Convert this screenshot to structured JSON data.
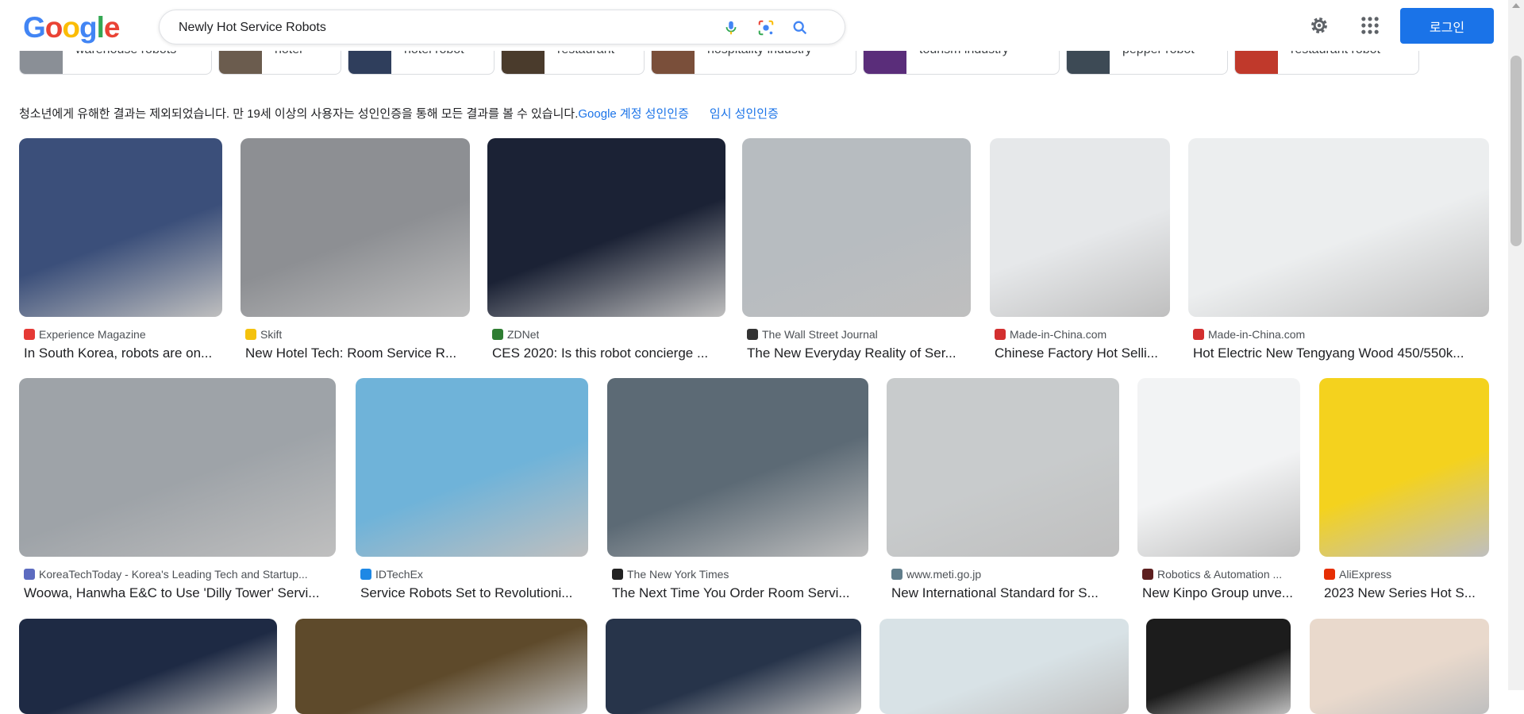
{
  "header": {
    "logo_letters": [
      "G",
      "o",
      "o",
      "g",
      "l",
      "e"
    ],
    "search_value": "Newly Hot Service Robots",
    "login_label": "로그인",
    "icons": [
      "mic-icon",
      "lens-icon",
      "search-icon",
      "gear-icon",
      "apps-icon"
    ]
  },
  "chips": [
    {
      "label": "warehouse robots",
      "color": "#8a8f96"
    },
    {
      "label": "hotel",
      "color": "#6b5c4e"
    },
    {
      "label": "hotel robot",
      "color": "#2f3e5c"
    },
    {
      "label": "restaurant",
      "color": "#4a3b2c"
    },
    {
      "label": "hospitality industry",
      "color": "#7a4f3a"
    },
    {
      "label": "tourism industry",
      "color": "#5a2d7a"
    },
    {
      "label": "pepper robot",
      "color": "#3d4a55"
    },
    {
      "label": "restaurant robot",
      "color": "#c0392b"
    }
  ],
  "notice": {
    "text": "청소년에게 유해한 결과는 제외되었습니다. 만 19세 이상의 사용자는 성인인증을 통해 모든 결과를 볼 수 있습니다.",
    "link1": "Google 계정 성인인증",
    "link2": "임시 성인인증"
  },
  "results": [
    {
      "source": "Experience Magazine",
      "title": "In South Korea, robots are on...",
      "fav": "#e53935",
      "bg": "#3b4f7a"
    },
    {
      "source": "Skift",
      "title": "New Hotel Tech: Room Service R...",
      "fav": "#f4c20d",
      "bg": "#8d8f93"
    },
    {
      "source": "ZDNet",
      "title": "CES 2020: Is this robot concierge ...",
      "fav": "#2e7d32",
      "bg": "#1b2235"
    },
    {
      "source": "The Wall Street Journal",
      "title": "The New Everyday Reality of Ser...",
      "fav": "#333333",
      "bg": "#b7bcc0"
    },
    {
      "source": "Made-in-China.com",
      "title": "Chinese Factory Hot Selli...",
      "fav": "#d32f2f",
      "bg": "#e6e8ea"
    },
    {
      "source": "Made-in-China.com",
      "title": "Hot Electric New Tengyang Wood 450/550k...",
      "fav": "#d32f2f",
      "bg": "#eceeef"
    },
    {
      "source": "KoreaTechToday - Korea's Leading Tech and Startup...",
      "title": "Woowa, Hanwha E&C to Use 'Dilly Tower' Servi...",
      "fav": "#5c6bc0",
      "bg": "#9ea3a8"
    },
    {
      "source": "IDTechEx",
      "title": "Service Robots Set to Revolutioni...",
      "fav": "#1e88e5",
      "bg": "#6fb3d9"
    },
    {
      "source": "The New York Times",
      "title": "The Next Time You Order Room Servi...",
      "fav": "#222222",
      "bg": "#5c6a75"
    },
    {
      "source": "www.meti.go.jp",
      "title": "New International Standard for S...",
      "fav": "#607d8b",
      "bg": "#c8cbcc"
    },
    {
      "source": "Robotics & Automation ...",
      "title": "New Kinpo Group unve...",
      "fav": "#5d1f1f",
      "bg": "#f2f3f4"
    },
    {
      "source": "AliExpress",
      "title": "2023 New Series Hot S...",
      "fav": "#e62e04",
      "bg": "#f4d21e"
    },
    {
      "source": "",
      "title": "",
      "fav": "",
      "bg": "#1e2a44"
    },
    {
      "source": "",
      "title": "",
      "fav": "",
      "bg": "#5e4a2b"
    },
    {
      "source": "",
      "title": "",
      "fav": "",
      "bg": "#27344a"
    },
    {
      "source": "",
      "title": "",
      "fav": "",
      "bg": "#d8e2e6"
    },
    {
      "source": "",
      "title": "",
      "fav": "",
      "bg": "#1c1c1c"
    },
    {
      "source": "",
      "title": "",
      "fav": "",
      "bg": "#e9d9cc"
    }
  ]
}
